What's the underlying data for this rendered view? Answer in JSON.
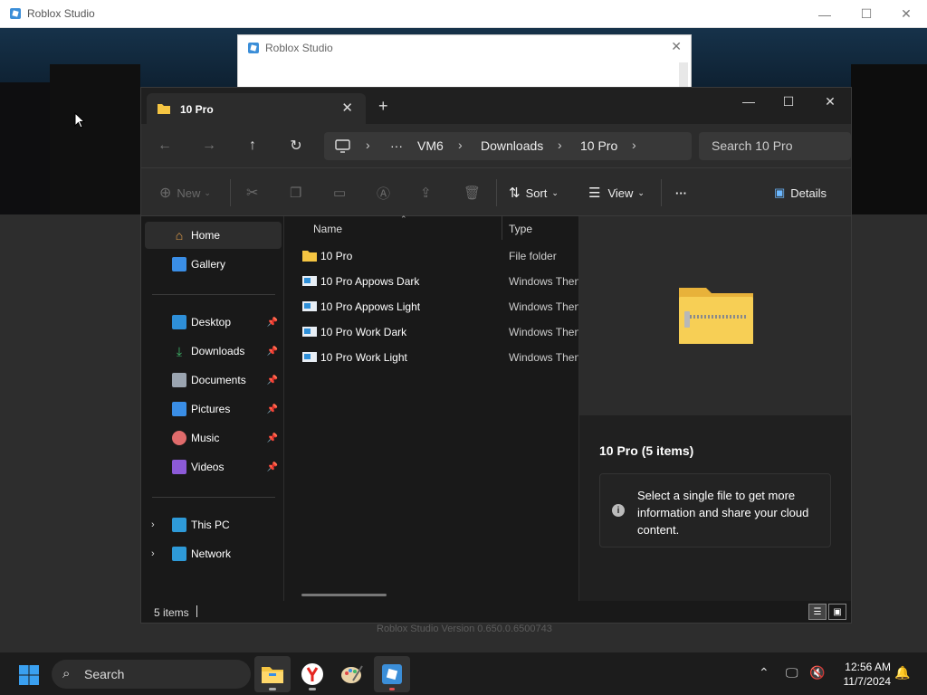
{
  "outer_window": {
    "title": "Roblox Studio",
    "version_text": "Roblox Studio Version 0.650.0.6500743"
  },
  "splash": {
    "title": "Roblox Studio"
  },
  "explorer": {
    "tab_title": "10 Pro",
    "breadcrumb": [
      "VM6",
      "Downloads",
      "10 Pro"
    ],
    "search_placeholder": "Search 10 Pro",
    "toolbar": {
      "new_label": "New",
      "sort_label": "Sort",
      "view_label": "View",
      "more_label": "···",
      "details_label": "Details"
    },
    "sidebar": {
      "top": [
        {
          "label": "Home",
          "icon": "home-icon"
        },
        {
          "label": "Gallery",
          "icon": "gallery-icon"
        }
      ],
      "quick": [
        {
          "label": "Desktop",
          "icon": "desktop-icon"
        },
        {
          "label": "Downloads",
          "icon": "downloads-icon"
        },
        {
          "label": "Documents",
          "icon": "documents-icon"
        },
        {
          "label": "Pictures",
          "icon": "pictures-icon"
        },
        {
          "label": "Music",
          "icon": "music-icon"
        },
        {
          "label": "Videos",
          "icon": "videos-icon"
        }
      ],
      "bottom": [
        {
          "label": "This PC",
          "icon": "this-pc-icon"
        },
        {
          "label": "Network",
          "icon": "network-icon"
        }
      ]
    },
    "columns": {
      "name": "Name",
      "type": "Type"
    },
    "files": [
      {
        "name": "10 Pro",
        "type": "File folder",
        "icon": "folder-icon"
      },
      {
        "name": "10 Pro Appows Dark",
        "type": "Windows Then",
        "icon": "theme-file-icon"
      },
      {
        "name": "10 Pro Appows Light",
        "type": "Windows Then",
        "icon": "theme-file-icon"
      },
      {
        "name": "10 Pro Work Dark",
        "type": "Windows Then",
        "icon": "theme-file-icon"
      },
      {
        "name": "10 Pro Work Light",
        "type": "Windows Then",
        "icon": "theme-file-icon"
      }
    ],
    "details_pane": {
      "title": "10 Pro (5 items)",
      "info": "Select a single file to get more information and share your cloud content."
    },
    "status": {
      "item_count": "5 items"
    }
  },
  "taskbar": {
    "search_label": "Search",
    "time": "12:56 AM",
    "date": "11/7/2024"
  },
  "colors": {
    "accent": "#0078d4",
    "folder": "#f5c542",
    "roblox": "#3b8ed8"
  }
}
